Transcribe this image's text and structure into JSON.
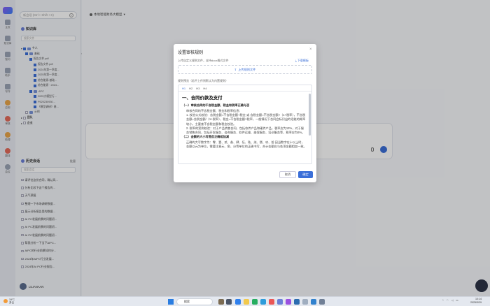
{
  "rail": {
    "items": [
      {
        "label": "主页",
        "icon": "home-icon"
      },
      {
        "label": "知识库",
        "icon": "database-icon"
      },
      {
        "label": "智问",
        "icon": "chat-icon"
      },
      {
        "label": "助手",
        "icon": "assistant-icon"
      },
      {
        "label": "写作",
        "icon": "write-icon"
      },
      {
        "label": "应用",
        "icon": "apps-icon"
      },
      {
        "label": "审核",
        "icon": "review-icon"
      },
      {
        "label": "助理",
        "icon": "avatar-icon"
      },
      {
        "label": "翻译",
        "icon": "translate-icon"
      },
      {
        "label": "会议",
        "icon": "meeting-icon"
      }
    ]
  },
  "sidebar": {
    "search_placeholder": "新会话 (Ctrl + Shift + K)",
    "kb_title": "知识库",
    "kb_search_placeholder": "搜索文件",
    "tree": [
      {
        "label": "个人",
        "level": 0,
        "checked": true,
        "folder": true,
        "bold": true
      },
      {
        "label": "基础",
        "level": 1,
        "checked": true,
        "folder": true,
        "ops": "⊕ ⋯ ↑"
      },
      {
        "label": "报告文件.pdf",
        "level": 2,
        "checked": true,
        "dot": true
      },
      {
        "label": "报告文件.pdf",
        "level": 3,
        "checked": true,
        "dot": true
      },
      {
        "label": "2024年第一季度...",
        "level": 3,
        "checked": true,
        "dot": true
      },
      {
        "label": "2025年第一季度...",
        "level": 3,
        "checked": true,
        "dot": true
      },
      {
        "label": "综合能源-基础...",
        "level": 3,
        "checked": true,
        "dot": true
      },
      {
        "label": "综合能源 · 2024...",
        "level": 3,
        "checked": true,
        "dot": true
      },
      {
        "label": "APC",
        "level": 2,
        "checked": true,
        "folder": true,
        "ops": "⋯ ↑"
      },
      {
        "label": "2025大模型行...",
        "level": 3,
        "checked": true,
        "dot": true
      },
      {
        "label": "P520230930...",
        "level": 3,
        "checked": true,
        "dot": true
      },
      {
        "label": "《模型调研》基...",
        "level": 3,
        "checked": true,
        "dot": true
      },
      {
        "label": "示例",
        "level": 1,
        "checked": false,
        "folder": true,
        "ops": "⋯ ↑"
      },
      {
        "label": "团队",
        "level": 0,
        "checked": false,
        "bold": true
      },
      {
        "label": "企业",
        "level": 0,
        "checked": false,
        "bold": true
      }
    ],
    "history_title": "历史会话",
    "history_action": "批量",
    "history_search_placeholder": "搜索会话",
    "history": [
      "请评估这份合同，确认风...",
      "分析比较下这个报告的...",
      "天气预报",
      "整理一下市场调研数据...",
      "展示分析报告里的数据...",
      "AI PC发展前景的问题初...",
      "AI PC发展前景的问题初...",
      "AI PC发展前景的问题初...",
      "帮我分析一下当下AIPC...",
      "AIPC的行业前景如何分...",
      "2024年AIPC行业发展...",
      "2024年AI PC行业报告..."
    ],
    "username": "LILIANAAN"
  },
  "main": {
    "model_label": "本地智能财务大模型"
  },
  "dialog": {
    "title": "设置审核规则",
    "close": "×",
    "hint": "上传自定义规则文件，支持docx格式文件",
    "download": "下载模板",
    "upload": "上传规则文件",
    "preview_label": "规则预览（若不上传则默认为内置规则）",
    "toolbar": [
      "H1",
      "H2",
      "H3",
      "H4"
    ],
    "content": {
      "h1": "一、合同价款及支付",
      "sections": [
        {
          "heading": "（一）审核合同的不含税金额、税金和税率正确与否",
          "paragraphs": [
            "审核合同的不含税金额、税金和税率信息：",
            "1. 校验公式校验：含税金额=不含税金额+税金 或 含税金额=不含税金额×（1+税率），不含税金额=含税金额/（1+税率），税金=不含税金额×税率，一般情况下合同会标识出的话能的概率较小，主要查不含税金额和税金校验。",
            "2. 税率的案例校验：对于产品销售合同，包括软件产品和硬件产品，税率应为13%，对于服务销售合同，包括开发服务、咨询服务、软件运维、维保服务、培训服务等，税率应为6%。"
          ]
        },
        {
          "heading": "（二）金额的大小写是否正确相加减",
          "paragraphs": [
            "正确的大写数字为：零、壹、贰、叁、肆、伍、陆、柒、捌、玖、拾 因当数字在十以上时，金额以元为单位，需要注意元、角、分等单位的正确书写，合计金额应与各项金额相加一致。"
          ]
        }
      ]
    },
    "cancel": "取消",
    "ok": "确定"
  },
  "taskbar": {
    "weather_temp": "19°C",
    "weather_desc": "多云",
    "search_label": "搜索",
    "time": "10:14",
    "date": "2025/3/29",
    "tray_icons": [
      "chevron-up-icon",
      "wifi-icon",
      "volume-icon",
      "battery-icon"
    ]
  },
  "colors": {
    "accent": "#3b6fd8",
    "ok_dot": "#37b24d"
  }
}
